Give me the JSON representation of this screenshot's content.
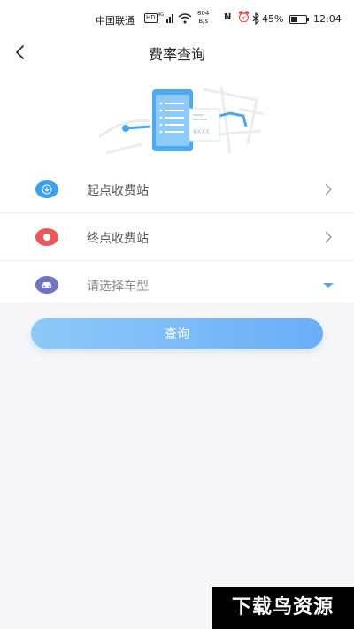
{
  "status_bar": {
    "carrier": "中国联通",
    "hd": "HD",
    "network": "4G",
    "net_speed_value": "804",
    "net_speed_unit": "B/s",
    "nfc": "N",
    "battery_percent": "45%",
    "battery_level": 0.45,
    "time": "12:04"
  },
  "header": {
    "title": "费率查询",
    "back_icon": "chevron-left-icon"
  },
  "hero": {
    "receipt_text": "¥XXX"
  },
  "form": {
    "rows": [
      {
        "label": "起点收费站",
        "icon": "arrow-down-circle-icon",
        "icon_color": "#3aa0f0",
        "trailing": "chevron-right-icon"
      },
      {
        "label": "终点收费站",
        "icon": "end-point-icon",
        "icon_color": "#e85a5a",
        "trailing": "chevron-right-icon"
      },
      {
        "label": "请选择车型",
        "icon": "car-icon",
        "icon_color": "#6f74c8",
        "trailing": "dropdown-triangle-icon"
      }
    ]
  },
  "actions": {
    "query_label": "查询"
  },
  "watermark": {
    "text": "下载鸟资源"
  },
  "colors": {
    "accent": "#6aaef7",
    "background": "#f6f6f8",
    "dropdown": "#5aa6e8"
  }
}
